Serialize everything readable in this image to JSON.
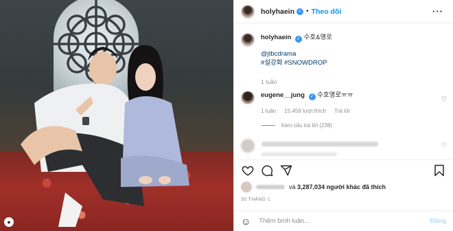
{
  "post": {
    "author": {
      "username": "holyhaein",
      "verified_icon": "verified-badge-icon",
      "follow_label": "Theo dõi"
    },
    "caption": {
      "text": "수호&영로",
      "mention": "@jtbcdrama",
      "hashtags": "#설강화 #SNOWDROP",
      "age": "1 tuần"
    },
    "comment": {
      "username": "eugene__jung",
      "text": "수호영로ㅠㅠ",
      "age": "1 tuần",
      "likes": "15.459 lượt thích",
      "reply_label": "Trả lời",
      "view_replies": "Xem câu trả lời (238)"
    },
    "likes_line": {
      "prefix": "và",
      "count": "3,287,034",
      "suffix": "người khác đã thích"
    },
    "date": "30 THÁNG 1",
    "add_comment": {
      "placeholder": "Thêm bình luận...",
      "post_label": "Đăng"
    }
  },
  "icons": {
    "more": "more-options-icon",
    "heart": "heart-icon",
    "comment": "comment-icon",
    "share": "share-icon",
    "save": "bookmark-icon",
    "emoji": "emoji-icon"
  },
  "colors": {
    "link_blue": "#0095f6",
    "verified_blue": "#3897f0",
    "post_disabled": "#b3dbff",
    "muted": "#8e8e8e"
  }
}
